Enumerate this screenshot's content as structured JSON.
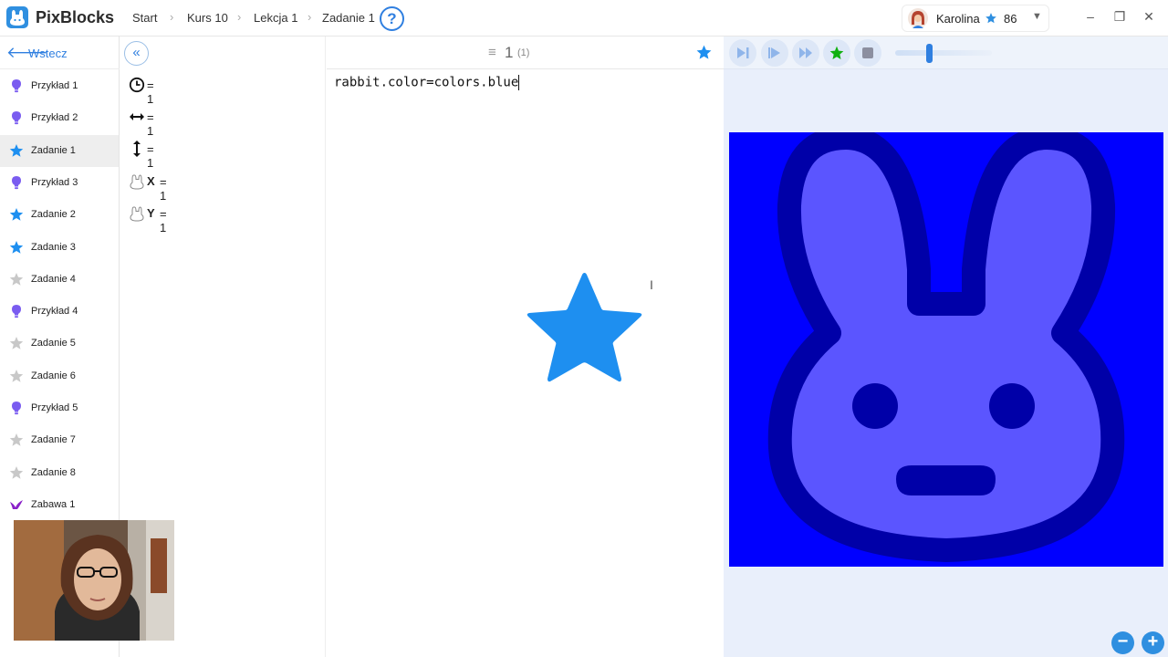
{
  "app": {
    "title": "PixBlocks"
  },
  "breadcrumb": [
    "Start",
    "Kurs 10",
    "Lekcja 1",
    "Zadanie 1"
  ],
  "help": {
    "label": "?"
  },
  "user": {
    "name": "Karolina",
    "points": "86"
  },
  "window_controls": {
    "minimize": "–",
    "maximize": "❐",
    "close": "✕"
  },
  "sidebar": {
    "back_label": "Wstecz",
    "items": [
      {
        "label": "Przykład 1",
        "icon": "bulb-icon"
      },
      {
        "label": "Przykład 2",
        "icon": "bulb-icon"
      },
      {
        "label": "Zadanie 1",
        "icon": "star-blue-icon",
        "active": true
      },
      {
        "label": "Przykład 3",
        "icon": "bulb-icon"
      },
      {
        "label": "Zadanie 2",
        "icon": "star-blue-icon"
      },
      {
        "label": "Zadanie 3",
        "icon": "star-blue-icon"
      },
      {
        "label": "Zadanie 4",
        "icon": "star-gray-icon"
      },
      {
        "label": "Przykład 4",
        "icon": "bulb-icon"
      },
      {
        "label": "Zadanie 5",
        "icon": "star-gray-icon"
      },
      {
        "label": "Zadanie 6",
        "icon": "star-gray-icon"
      },
      {
        "label": "Przykład 5",
        "icon": "bulb-icon"
      },
      {
        "label": "Zadanie 7",
        "icon": "star-gray-icon"
      },
      {
        "label": "Zadanie 8",
        "icon": "star-gray-icon"
      },
      {
        "label": "Zabawa 1",
        "icon": "bird-icon"
      }
    ]
  },
  "variables": {
    "collapse_label": "«",
    "rows": [
      {
        "icon": "clock-icon",
        "name": "",
        "value": "= 1"
      },
      {
        "icon": "horizontal-arrow-icon",
        "name": "",
        "value": "= 1"
      },
      {
        "icon": "vertical-arrow-icon",
        "name": "",
        "value": "= 1"
      },
      {
        "icon": "rabbit-icon",
        "name": "X",
        "value": "= 1"
      },
      {
        "icon": "rabbit-icon",
        "name": "Y",
        "value": "= 1"
      }
    ]
  },
  "editor": {
    "lines_icon": "≡",
    "line_number": "1",
    "line_count": "(1)",
    "code": "rabbit.color=colors.blue",
    "text_cursor": "I"
  },
  "stage": {
    "canvas_color": "#0000ff",
    "rabbit_fill": "#5b55ff",
    "rabbit_outline": "#0000a8",
    "zoom_out": "−",
    "zoom_in": "+"
  },
  "colors": {
    "accent": "#2f7fe0",
    "star_blue": "#1e8ff0",
    "star_gray": "#c8c8c8",
    "bulb": "#7a5cf0"
  }
}
